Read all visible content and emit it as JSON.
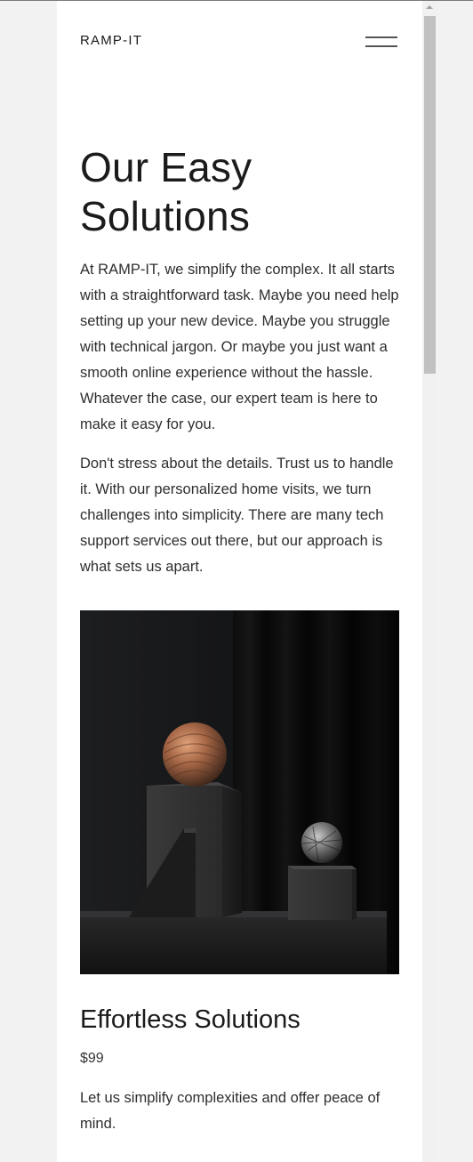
{
  "header": {
    "logo": "RAMP-IT",
    "menu_icon": "hamburger-menu-icon"
  },
  "hero": {
    "title": "Our Easy Solutions",
    "paragraphs": [
      "At RAMP-IT, we simplify the complex. It all starts with a straightforward task. Maybe you need help setting up your new device. Maybe you struggle with technical jargon. Or maybe you just want a smooth online experience without the hassle. Whatever the case, our expert team is here to make it easy for you.",
      "Don't stress about the details. Trust us to handle it. With our personalized home visits, we turn challenges into simplicity. There are many tech support services out there, but our approach is what sets us apart."
    ]
  },
  "product": {
    "title": "Effortless Solutions",
    "price": "$99",
    "description": "Let us simplify complexities and offer peace of mind."
  },
  "colors": {
    "page_background": "#ffffff",
    "outer_background": "#f2f2f2",
    "text": "#1f1f1f",
    "image_background": "#0b0b0c"
  }
}
